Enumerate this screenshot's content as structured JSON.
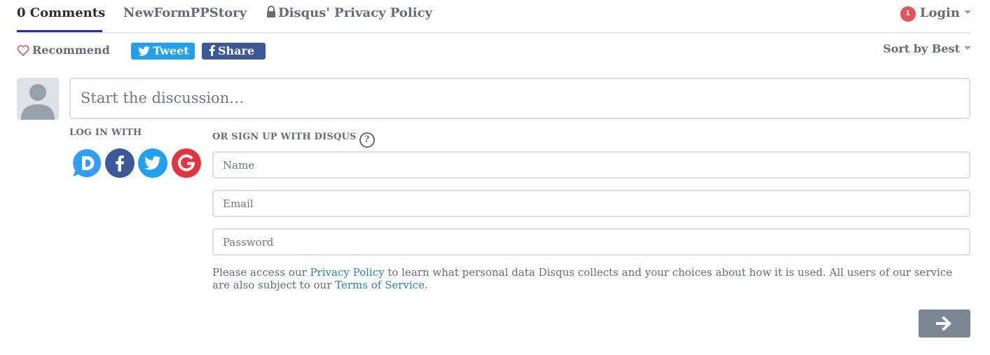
{
  "nav": {
    "tabs": [
      {
        "label": "0 Comments"
      },
      {
        "label": "NewFormPPStory"
      },
      {
        "label": "Disqus' Privacy Policy"
      }
    ],
    "login": {
      "badge": "1",
      "label": "Login"
    }
  },
  "actions": {
    "recommend": "Recommend",
    "tweet": "Tweet",
    "share": "Share",
    "sort": "Sort by Best"
  },
  "composer": {
    "placeholder": "Start the discussion…"
  },
  "login_with": {
    "label": "LOG IN WITH",
    "providers": [
      "disqus-icon",
      "facebook-icon",
      "twitter-icon",
      "google-icon"
    ]
  },
  "signup": {
    "label": "OR SIGN UP WITH DISQUS",
    "help": "?",
    "name_placeholder": "Name",
    "email_placeholder": "Email",
    "password_placeholder": "Password"
  },
  "policy": {
    "part1": "Please access our ",
    "privacy_link": "Privacy Policy",
    "part2": " to learn what personal data Disqus collects and your choices about how it is used. All users of our service are also subject to our ",
    "terms_link": "Terms of Service",
    "part3": "."
  },
  "colors": {
    "accent": "#1d2fbf",
    "twitter": "#1da1f2",
    "facebook": "#3b5998",
    "google": "#e8333f",
    "disqus": "#2e9fff",
    "badge": "#e9525b",
    "submit": "#7b8793"
  }
}
